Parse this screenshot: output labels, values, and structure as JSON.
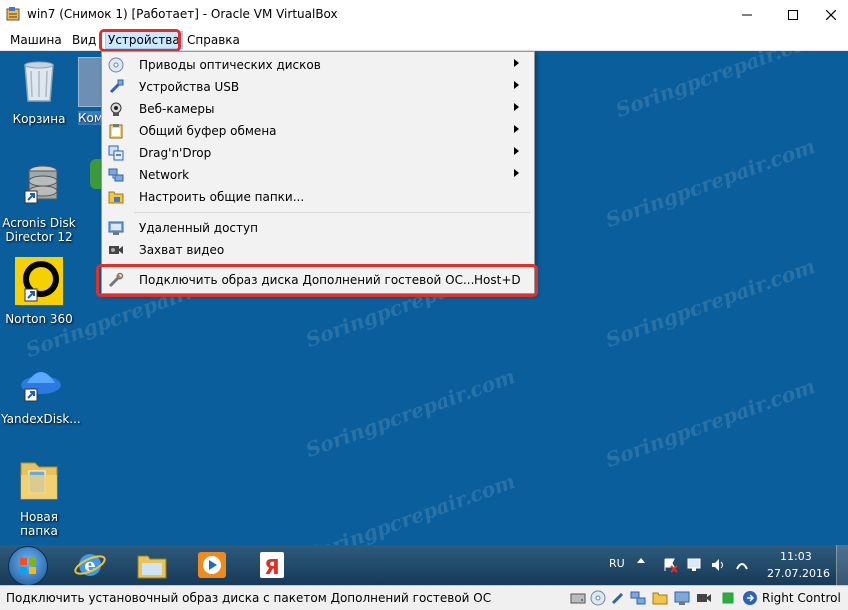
{
  "window": {
    "title": "win7 (Снимок 1) [Работает] - Oracle VM VirtualBox"
  },
  "menubar": {
    "items": [
      "Машина",
      "Вид",
      "Устройства",
      "Справка"
    ]
  },
  "devices_menu": {
    "items": [
      {
        "label": "Приводы оптических дисков",
        "icon": "optical-disc-icon",
        "submenu": true
      },
      {
        "label": "Устройства USB",
        "icon": "usb-icon",
        "submenu": true
      },
      {
        "label": "Веб-камеры",
        "icon": "webcam-icon",
        "submenu": true
      },
      {
        "label": "Общий буфер обмена",
        "icon": "clipboard-icon",
        "submenu": true
      },
      {
        "label": "Drag'n'Drop",
        "icon": "drag-drop-icon",
        "submenu": true
      },
      {
        "label": "Network",
        "icon": "network-icon",
        "submenu": true
      },
      {
        "label": "Настроить общие папки...",
        "icon": "shared-folder-icon",
        "submenu": false
      },
      {
        "label": "Удаленный доступ",
        "icon": "remote-display-icon",
        "submenu": false
      },
      {
        "label": "Захват видео",
        "icon": "video-capture-icon",
        "submenu": false
      },
      {
        "label": "Подключить образ диска Дополнений гостевой ОС...",
        "icon": "guest-additions-icon",
        "shortcut": "Host+D",
        "submenu": false
      }
    ]
  },
  "desktop": {
    "icons": [
      {
        "label": "Корзина",
        "icon": "recycle-bin-icon"
      },
      {
        "label": "Ком",
        "icon": "computer-icon"
      },
      {
        "label": "Acronis Disk Director 12",
        "icon": "acronis-icon"
      },
      {
        "label": "Norton 360",
        "icon": "norton-icon"
      },
      {
        "label": "YandexDisk...",
        "icon": "yandex-disk-icon"
      },
      {
        "label": "Новая папка",
        "icon": "folder-icon"
      }
    ],
    "watermark": "Soringpcrepair.com"
  },
  "taskbar": {
    "apps": [
      "internet-explorer-icon",
      "explorer-icon",
      "media-player-icon",
      "yandex-browser-icon"
    ],
    "language": "RU",
    "time": "11:03",
    "date": "27.07.2016"
  },
  "statusbar": {
    "text": "Подключить установочный образ диска с пакетом Дополнений гостевой ОС",
    "host_key": "Right Control"
  },
  "colors": {
    "highlight": "#e0302c",
    "desktop": "#0a5e9b"
  }
}
